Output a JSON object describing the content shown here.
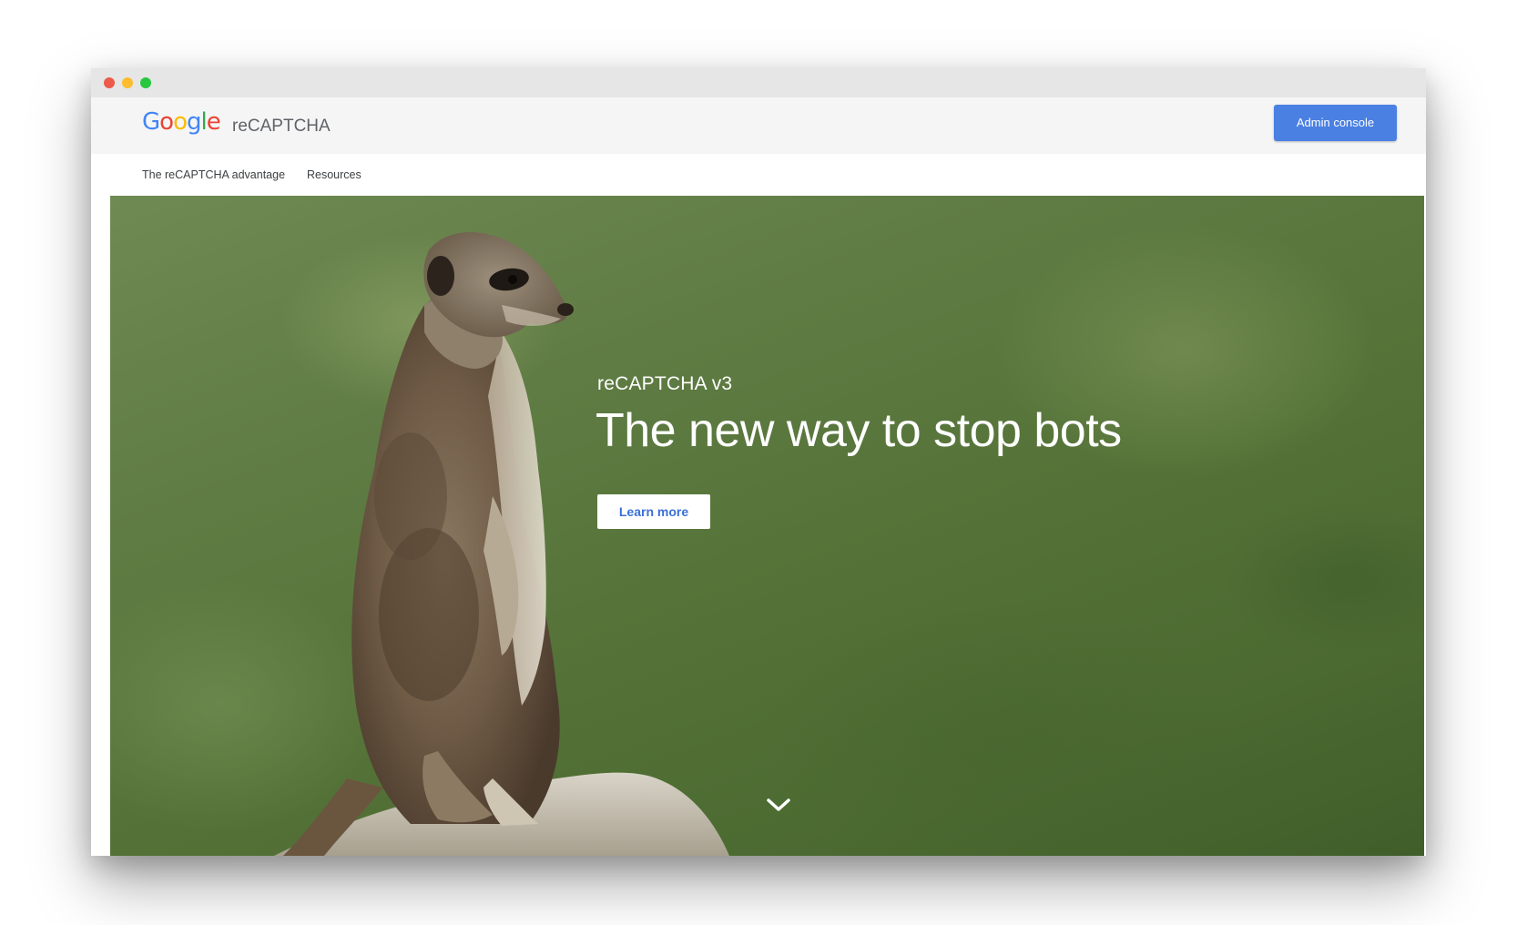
{
  "window": {
    "controls": [
      "close",
      "minimize",
      "maximize"
    ],
    "colors": {
      "close": "#ed594a",
      "minimize": "#fdbd2e",
      "maximize": "#27c840"
    }
  },
  "header": {
    "logo_letters": [
      "G",
      "o",
      "o",
      "g",
      "l",
      "e"
    ],
    "logo_colors": [
      "#4285f4",
      "#ea4335",
      "#fbbc05",
      "#4285f4",
      "#34a853",
      "#ea4335"
    ],
    "product_name": "reCAPTCHA",
    "admin_button": "Admin console",
    "accent": "#4a80e2"
  },
  "nav": {
    "items": [
      {
        "label": "The reCAPTCHA advantage"
      },
      {
        "label": "Resources"
      }
    ]
  },
  "hero": {
    "subtitle": "reCAPTCHA v3",
    "title": "The new way to stop bots",
    "cta": "Learn more",
    "scroll_icon": "chevron-down-icon"
  }
}
